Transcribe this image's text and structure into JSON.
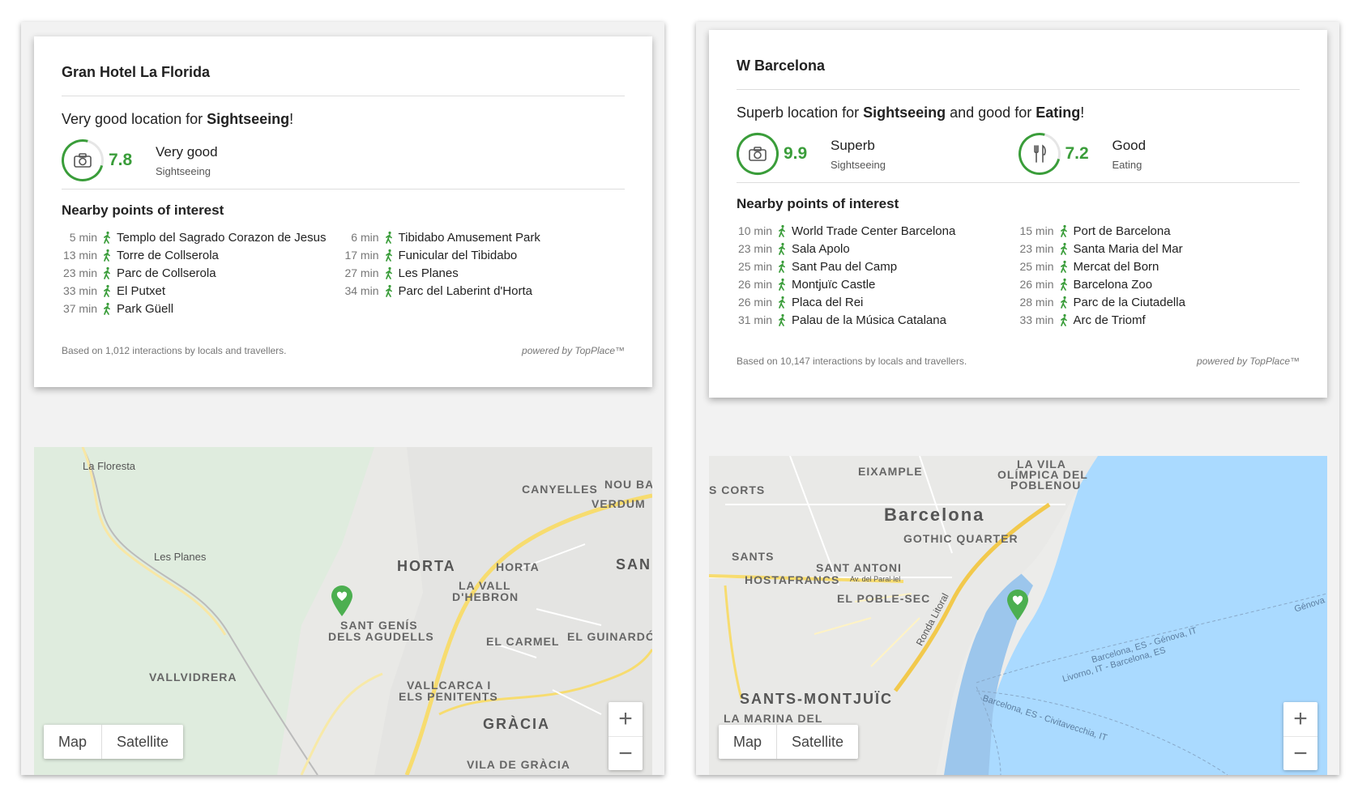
{
  "left": {
    "hotel_name": "Gran Hotel La Florida",
    "summary": {
      "prefix": "Very good location for ",
      "cat1": "Sightseeing",
      "suffix": "!"
    },
    "scores": [
      {
        "value": "7.8",
        "word": "Very good",
        "category": "Sightseeing",
        "icon": "camera-icon"
      }
    ],
    "poi_title": "Nearby points of interest",
    "poi_col1": [
      {
        "min": "5 min",
        "name": "Templo del Sagrado Corazon de Jesus"
      },
      {
        "min": "13 min",
        "name": "Torre de Collserola"
      },
      {
        "min": "23 min",
        "name": "Parc de Collserola"
      },
      {
        "min": "33 min",
        "name": "El Putxet"
      },
      {
        "min": "37 min",
        "name": "Park Güell"
      }
    ],
    "poi_col2": [
      {
        "min": "6 min",
        "name": "Tibidabo Amusement Park"
      },
      {
        "min": "17 min",
        "name": "Funicular del Tibidabo"
      },
      {
        "min": "27 min",
        "name": "Les Planes"
      },
      {
        "min": "34 min",
        "name": "Parc del Laberint d'Horta"
      }
    ],
    "footer_left": "Based on 1,012 interactions by locals and travellers.",
    "footer_right": "powered by TopPlace™",
    "map_labels": {
      "la_floresta": "La Floresta",
      "les_planes": "Les Planes",
      "canyelles": "CANYELLES",
      "nou_bar": "NOU BAR",
      "verdum": "VERDUM",
      "horta_big": "HORTA",
      "horta": "HORTA",
      "san": "SAN",
      "la_vall": "LA VALL",
      "dhebron": "D'HEBRON",
      "sant_genis": "SANT GENÍS",
      "dels_agudells": "DELS AGUDELLS",
      "vallvidrera": "VALLVIDRERA",
      "el_carmel": "EL CARMEL",
      "el_guinardo": "EL GUINARDÓ",
      "vallcarca": "VALLCARCA I",
      "els_penitents": "ELS PENITENTS",
      "gracia": "GRÀCIA",
      "vila_gracia": "VILA DE GRÀCIA"
    }
  },
  "right": {
    "hotel_name": "W Barcelona",
    "summary": {
      "prefix": "Superb location for ",
      "cat1": "Sightseeing",
      "middle": " and good for ",
      "cat2": "Eating",
      "suffix": "!"
    },
    "scores": [
      {
        "value": "9.9",
        "word": "Superb",
        "category": "Sightseeing",
        "icon": "camera-icon"
      },
      {
        "value": "7.2",
        "word": "Good",
        "category": "Eating",
        "icon": "fork-knife-icon"
      }
    ],
    "poi_title": "Nearby points of interest",
    "poi_col1": [
      {
        "min": "10 min",
        "name": "World Trade Center Barcelona"
      },
      {
        "min": "23 min",
        "name": "Sala Apolo"
      },
      {
        "min": "25 min",
        "name": "Sant Pau del Camp"
      },
      {
        "min": "26 min",
        "name": "Montjuïc Castle"
      },
      {
        "min": "26 min",
        "name": "Placa del Rei"
      },
      {
        "min": "31 min",
        "name": "Palau de la Música Catalana"
      }
    ],
    "poi_col2": [
      {
        "min": "15 min",
        "name": "Port de Barcelona"
      },
      {
        "min": "23 min",
        "name": "Santa Maria del Mar"
      },
      {
        "min": "25 min",
        "name": "Mercat del Born"
      },
      {
        "min": "26 min",
        "name": "Barcelona Zoo"
      },
      {
        "min": "28 min",
        "name": "Parc de la Ciutadella"
      },
      {
        "min": "33 min",
        "name": "Arc de Triomf"
      }
    ],
    "footer_left": "Based on 10,147 interactions by locals and travellers.",
    "footer_right": "powered by TopPlace™",
    "map_labels": {
      "eixample": "EIXAMPLE",
      "la_vila": "LA VILA",
      "olimpica": "OLÍMPICA DEL",
      "poblenou": "POBLENOU",
      "s_corts": "S CORTS",
      "barcelona": "Barcelona",
      "gothic": "GOTHIC QUARTER",
      "sants": "SANTS",
      "sant_antoni": "SANT ANTONI",
      "hostafrancs": "HOSTAFRANCS",
      "av_parallel": "Av. del Paral·lel",
      "el_poble_sec": "EL POBLE-SEC",
      "ronda_litoral": "Ronda Litoral",
      "sants_montjuic": "SANTS-MONTJUÏC",
      "la_marina": "LA MARINA DEL",
      "genova": "Génova",
      "route1": "Barcelona, ES - Génova, IT",
      "route2": "Livorno, IT - Barcelona, ES",
      "route3": "Barcelona, ES - Civitavecchia, IT"
    }
  },
  "map_controls": {
    "map": "Map",
    "satellite": "Satellite",
    "zoom_in": "+",
    "zoom_out": "−"
  },
  "colors": {
    "accent": "#3a9d3a",
    "water": "#aadaff",
    "land": "#e8e8e4",
    "park": "#dfeede"
  }
}
